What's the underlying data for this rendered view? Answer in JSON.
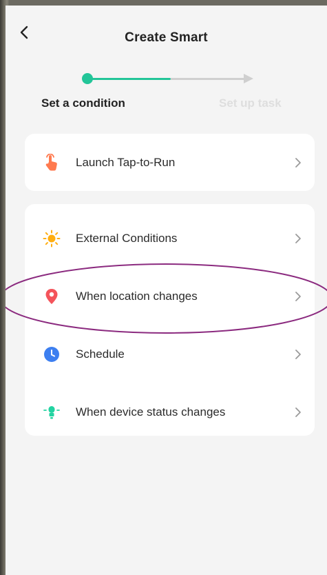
{
  "header": {
    "title": "Create Smart"
  },
  "stepper": {
    "step1_label": "Set a condition",
    "step2_label": "Set up task"
  },
  "options": {
    "launch": {
      "label": "Launch Tap-to-Run",
      "icon": "hand-tap-icon"
    },
    "external": {
      "label": "External Conditions",
      "icon": "sun-icon"
    },
    "location": {
      "label": "When location changes",
      "icon": "location-pin-icon"
    },
    "schedule": {
      "label": "Schedule",
      "icon": "clock-icon"
    },
    "device": {
      "label": "When device status changes",
      "icon": "device-bulb-icon"
    }
  },
  "colors": {
    "accent": "#22c598",
    "annotation": "#8b2a7f",
    "location_icon": "#f4545b",
    "schedule_icon": "#3d7ff0",
    "sun_icon": "#ffae12",
    "hand_icon": "#ff7a4f",
    "device_icon": "#22d3a1"
  }
}
